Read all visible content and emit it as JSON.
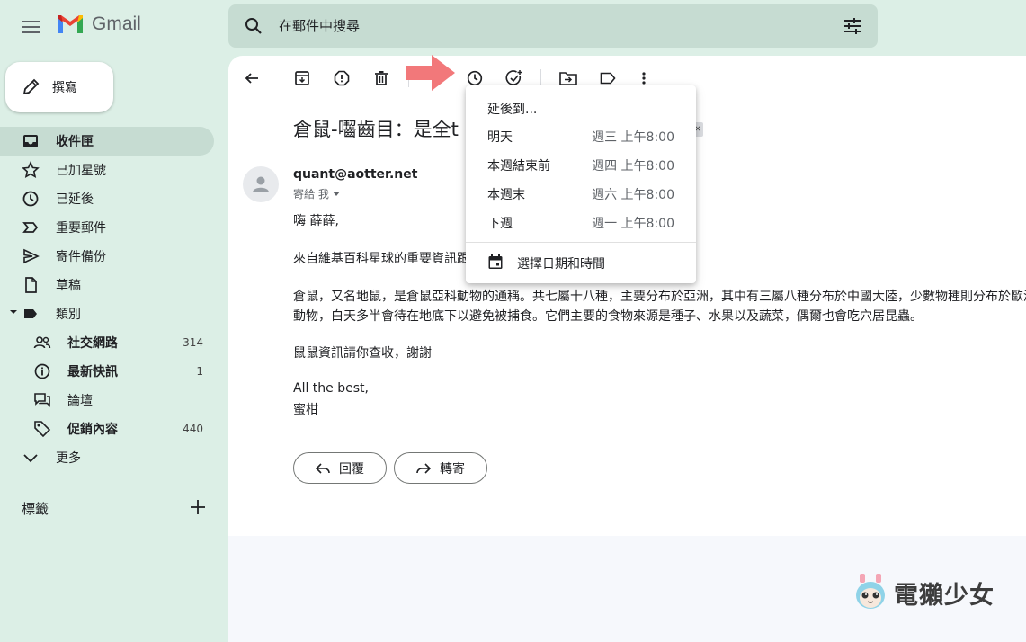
{
  "header": {
    "app_name": "Gmail",
    "search_placeholder": "在郵件中搜尋"
  },
  "compose": {
    "label": "撰寫"
  },
  "sidebar": {
    "items": [
      {
        "label": "收件匣",
        "icon": "inbox-icon",
        "active": true
      },
      {
        "label": "已加星號",
        "icon": "star-icon"
      },
      {
        "label": "已延後",
        "icon": "clock-icon"
      },
      {
        "label": "重要郵件",
        "icon": "important-icon"
      },
      {
        "label": "寄件備份",
        "icon": "send-icon"
      },
      {
        "label": "草稿",
        "icon": "draft-icon"
      },
      {
        "label": "類別",
        "icon": "label-icon"
      }
    ],
    "categories": [
      {
        "label": "社交網路",
        "count": "314",
        "icon": "people-icon"
      },
      {
        "label": "最新快訊",
        "count": "1",
        "icon": "info-icon"
      },
      {
        "label": "論壇",
        "count": "",
        "icon": "forum-icon"
      },
      {
        "label": "促銷內容",
        "count": "440",
        "icon": "tag-icon"
      }
    ],
    "more_label": "更多",
    "labels_title": "標籤"
  },
  "email": {
    "subject": "倉鼠-囓齒目：是全t",
    "tag_close": "×",
    "sender": "quant@aotter.net",
    "to_me": "寄給 我",
    "greeting": "嗨 薛薛,",
    "line1": "來自維基百科星球的重要資訊跟",
    "line2": "倉鼠，又名地鼠，是倉鼠亞科動物的通稱。共七屬十八種，主要分布於亞洲，其中有三屬八種分布於中國大陸，少數物種則分布於歐洲",
    "line3": "動物，白天多半會待在地底下以避免被捕食。它們主要的食物來源是種子、水果以及蔬菜，偶爾也會吃穴居昆蟲。",
    "line4": "鼠鼠資訊請你查收，謝謝",
    "signoff": "All the best,",
    "signature": "蜜柑",
    "reply_label": "回覆",
    "forward_label": "轉寄"
  },
  "snooze_menu": {
    "title": "延後到...",
    "options": [
      {
        "label": "明天",
        "time": "週三 上午8:00"
      },
      {
        "label": "本週結束前",
        "time": "週四 上午8:00"
      },
      {
        "label": "本週末",
        "time": "週六 上午8:00"
      },
      {
        "label": "下週",
        "time": "週一 上午8:00"
      }
    ],
    "custom_label": "選擇日期和時間"
  },
  "watermark": {
    "text": "電獺少女"
  },
  "colors": {
    "background": "#dcefe6",
    "search_bg": "#c6dcd2",
    "active_nav": "#c6dcd2",
    "arrow_pink": "#f2787a"
  }
}
